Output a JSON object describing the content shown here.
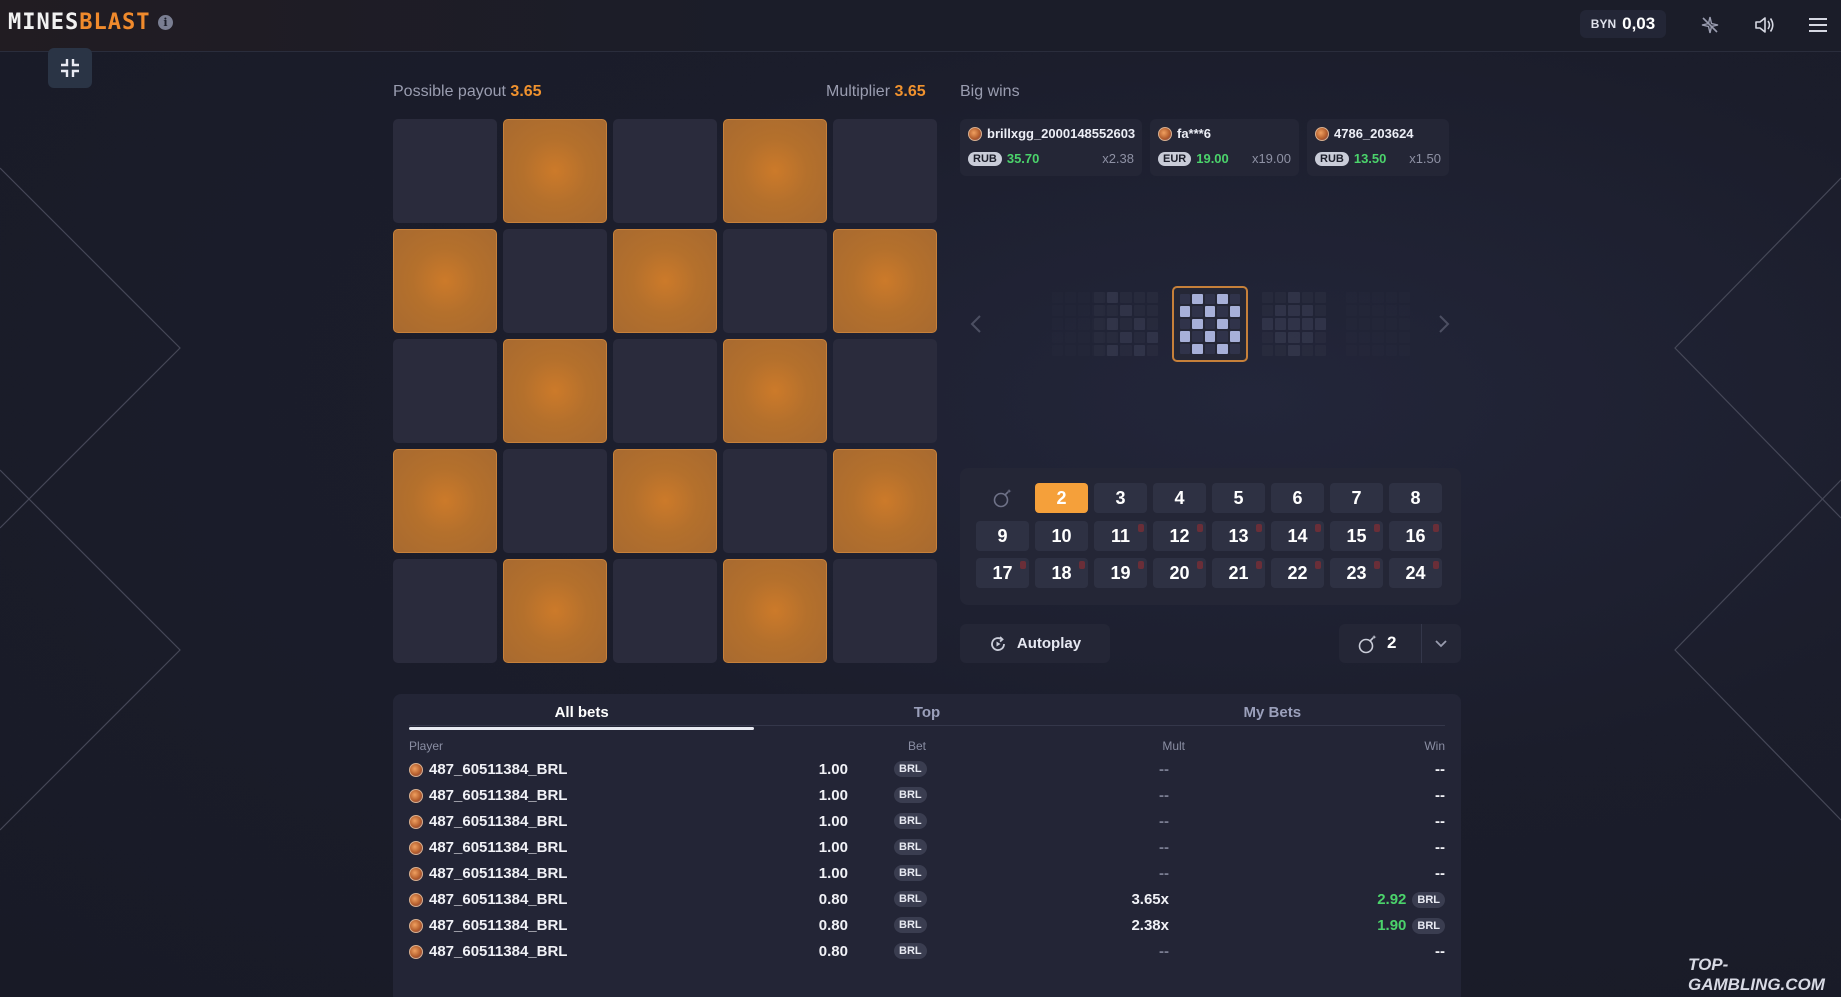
{
  "header": {
    "logo_part1": "MINES",
    "logo_part2": "BLAST",
    "balance_currency": "BYN",
    "balance_amount": "0,03"
  },
  "game": {
    "payout_label": "Possible payout",
    "payout_value": "3.65",
    "multiplier_label": "Multiplier",
    "multiplier_value": "3.65",
    "grid_state": [
      [
        0,
        1,
        0,
        1,
        0
      ],
      [
        1,
        0,
        1,
        0,
        1
      ],
      [
        0,
        1,
        0,
        1,
        0
      ],
      [
        1,
        0,
        1,
        0,
        1
      ],
      [
        0,
        1,
        0,
        1,
        0
      ]
    ]
  },
  "big_wins": {
    "title": "Big wins",
    "items": [
      {
        "user": "brillxgg_2000148552603",
        "currency": "RUB",
        "amount": "35.70",
        "mult": "x2.38"
      },
      {
        "user": "fa***6",
        "currency": "EUR",
        "amount": "19.00",
        "mult": "x19.00"
      },
      {
        "user": "4786_203624",
        "currency": "RUB",
        "amount": "13.50",
        "mult": "x1.50"
      }
    ]
  },
  "mines_selector": {
    "options": [
      "2",
      "3",
      "4",
      "5",
      "6",
      "7",
      "8",
      "9",
      "10",
      "11",
      "12",
      "13",
      "14",
      "15",
      "16",
      "17",
      "18",
      "19",
      "20",
      "21",
      "22",
      "23",
      "24"
    ],
    "selected": "2",
    "marked": [
      "11",
      "12",
      "13",
      "14",
      "15",
      "16",
      "17",
      "18",
      "19",
      "20",
      "21",
      "22",
      "23",
      "24"
    ]
  },
  "controls": {
    "autoplay_label": "Autoplay",
    "mines_count": "2"
  },
  "bets": {
    "tabs": [
      "All bets",
      "Top",
      "My Bets"
    ],
    "active_tab": "All bets",
    "columns": {
      "player": "Player",
      "bet": "Bet",
      "mult": "Mult",
      "win": "Win"
    },
    "rows": [
      {
        "player": "487_60511384_BRL",
        "bet": "1.00",
        "currency": "BRL",
        "mult": "--",
        "win": "--",
        "win_currency": ""
      },
      {
        "player": "487_60511384_BRL",
        "bet": "1.00",
        "currency": "BRL",
        "mult": "--",
        "win": "--",
        "win_currency": ""
      },
      {
        "player": "487_60511384_BRL",
        "bet": "1.00",
        "currency": "BRL",
        "mult": "--",
        "win": "--",
        "win_currency": ""
      },
      {
        "player": "487_60511384_BRL",
        "bet": "1.00",
        "currency": "BRL",
        "mult": "--",
        "win": "--",
        "win_currency": ""
      },
      {
        "player": "487_60511384_BRL",
        "bet": "1.00",
        "currency": "BRL",
        "mult": "--",
        "win": "--",
        "win_currency": ""
      },
      {
        "player": "487_60511384_BRL",
        "bet": "0.80",
        "currency": "BRL",
        "mult": "3.65x",
        "win": "2.92",
        "win_currency": "BRL"
      },
      {
        "player": "487_60511384_BRL",
        "bet": "0.80",
        "currency": "BRL",
        "mult": "2.38x",
        "win": "1.90",
        "win_currency": "BRL"
      },
      {
        "player": "487_60511384_BRL",
        "bet": "0.80",
        "currency": "BRL",
        "mult": "--",
        "win": "--",
        "win_currency": ""
      }
    ]
  },
  "watermark": "TOP-GAMBLING.COM",
  "colors": {
    "accent": "#f0922e",
    "tile_open": "#b4702c",
    "tile_closed": "#2a2b3c",
    "win_green": "#4bd36b"
  }
}
